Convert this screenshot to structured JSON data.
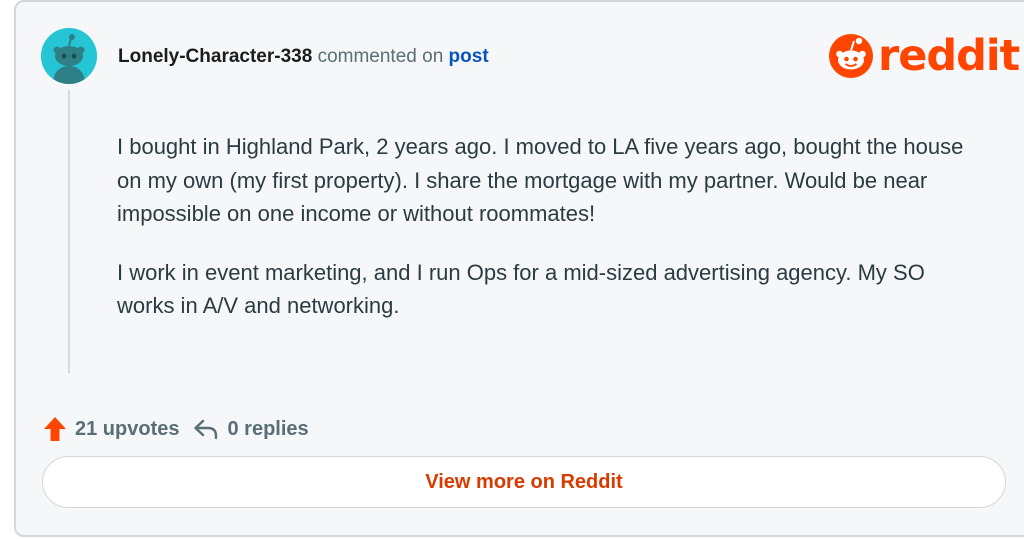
{
  "comment": {
    "username": "Lonely-Character-338",
    "action_text": "commented on",
    "post_link": "post",
    "avatar_icon": "snoo-avatar-icon",
    "paragraphs": [
      "I bought in Highland Park, 2 years ago. I moved to LA five years ago, bought the house on my own (my first property). I share the mortgage with my partner. Would be near impossible on one income or without roommates!",
      "I work in event marketing, and I run Ops for a mid-sized advertising agency. My SO works in A/V and networking."
    ]
  },
  "brand": {
    "name": "reddit",
    "icon": "reddit-snoo-icon",
    "color": "#ff4500"
  },
  "actions": {
    "upvote_icon": "upvote-arrow-icon",
    "upvotes_label": "21 upvotes",
    "reply_icon": "reply-arrow-icon",
    "replies_label": "0 replies"
  },
  "cta": {
    "label": "View more on Reddit"
  }
}
